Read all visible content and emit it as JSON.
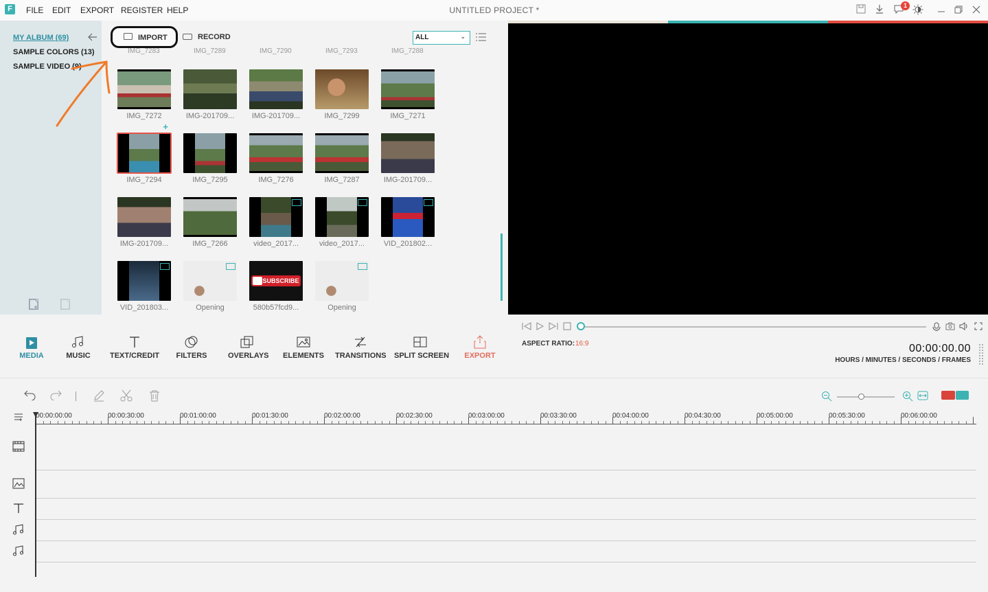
{
  "app": {
    "logo_letter": "F",
    "title": "UNTITLED PROJECT *",
    "menu": [
      "FILE",
      "EDIT",
      "EXPORT",
      "REGISTER",
      "HELP"
    ],
    "notification_count": "1",
    "icons": [
      "save-icon",
      "download-icon",
      "chat-icon",
      "brightness-icon",
      "minimize-icon",
      "restore-icon",
      "close-icon"
    ]
  },
  "album": {
    "items": [
      "MY ALBUM (69)",
      "SAMPLE COLORS (13)",
      "SAMPLE VIDEO (9)"
    ],
    "active_index": 0
  },
  "media": {
    "import_label": "IMPORT",
    "record_label": "RECORD",
    "filter_value": "ALL",
    "partial_row_captions": [
      "IMG_7283",
      "IMG_7289",
      "IMG_7290",
      "IMG_7293",
      "IMG_7288"
    ],
    "items": [
      {
        "caption": "IMG_7272",
        "kind": "photo"
      },
      {
        "caption": "IMG-201709...",
        "kind": "photo"
      },
      {
        "caption": "IMG-201709...",
        "kind": "photo"
      },
      {
        "caption": "IMG_7299",
        "kind": "photo"
      },
      {
        "caption": "IMG_7271",
        "kind": "photo"
      },
      {
        "caption": "IMG_7294",
        "kind": "photo",
        "selected": true
      },
      {
        "caption": "IMG_7295",
        "kind": "photo"
      },
      {
        "caption": "IMG_7276",
        "kind": "photo"
      },
      {
        "caption": "IMG_7287",
        "kind": "photo"
      },
      {
        "caption": "IMG-201709...",
        "kind": "photo"
      },
      {
        "caption": "IMG-201709...",
        "kind": "photo"
      },
      {
        "caption": "IMG_7266",
        "kind": "photo"
      },
      {
        "caption": "video_2017...",
        "kind": "video"
      },
      {
        "caption": "video_2017...",
        "kind": "video"
      },
      {
        "caption": "VID_201802...",
        "kind": "video"
      },
      {
        "caption": "VID_201803...",
        "kind": "video"
      },
      {
        "caption": "Opening",
        "kind": "video"
      },
      {
        "caption": "580b57fcd9...",
        "kind": "image",
        "overlay_text": "SUBSCRIBE"
      },
      {
        "caption": "Opening",
        "kind": "video"
      }
    ]
  },
  "player": {
    "aspect_label": "ASPECT RATIO:",
    "aspect_value": "16:9",
    "timecode": "00:00:00.00",
    "timecode_units": "HOURS / MINUTES / SECONDS / FRAMES",
    "progress": 0
  },
  "tools": [
    {
      "label": "MEDIA",
      "icon": "media-icon",
      "active": true
    },
    {
      "label": "MUSIC",
      "icon": "music-icon"
    },
    {
      "label": "TEXT/CREDIT",
      "icon": "text-icon"
    },
    {
      "label": "FILTERS",
      "icon": "filters-icon"
    },
    {
      "label": "OVERLAYS",
      "icon": "overlays-icon"
    },
    {
      "label": "ELEMENTS",
      "icon": "elements-icon"
    },
    {
      "label": "TRANSITIONS",
      "icon": "transitions-icon"
    },
    {
      "label": "SPLIT SCREEN",
      "icon": "split-screen-icon"
    },
    {
      "label": "EXPORT",
      "icon": "export-icon",
      "accent": true
    }
  ],
  "timeline": {
    "ruler_labels": [
      "00:00:00:00",
      "00:00:30:00",
      "00:01:00:00",
      "00:01:30:00",
      "00:02:00:00",
      "00:02:30:00",
      "00:03:00:00",
      "00:03:30:00",
      "00:04:00:00",
      "00:04:30:00",
      "00:05:00:00",
      "00:05:30:00",
      "00:06:00:00"
    ],
    "track_icons": [
      "film-track-icon",
      "image-track-icon",
      "text-track-icon",
      "music-track-icon",
      "music-track-icon"
    ]
  },
  "colors": {
    "accent_teal": "#3cb3b2",
    "accent_red": "#e24c3f",
    "active_tool": "#2f8fa3",
    "annotation_arrow": "#f07a2a"
  }
}
